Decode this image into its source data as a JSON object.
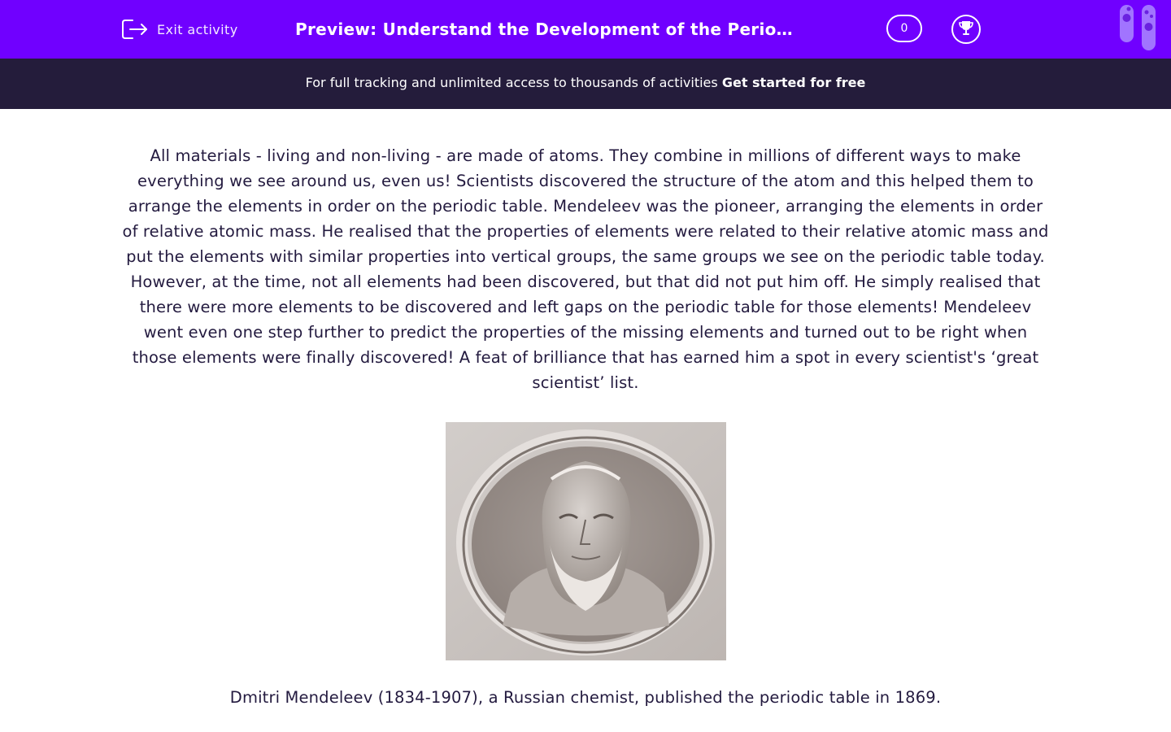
{
  "header": {
    "exit_label": "Exit activity",
    "title": "Preview: Understand the Development of the Periodic Table",
    "score": "0",
    "colors": {
      "primary": "#7000ff",
      "banner": "#241c3b",
      "text": "#231a3f"
    },
    "icons": {
      "exit": "exit-icon",
      "trophy": "trophy-icon",
      "tubes": "test-tubes-icon"
    }
  },
  "banner": {
    "text": "For full tracking and unlimited access to thousands of activities ",
    "link": "Get started for free"
  },
  "main": {
    "paragraph": "All materials - living and non-living - are made of atoms. They combine in millions of different ways to make everything we see around us, even us! Scientists discovered the structure of the atom and this helped them to arrange the elements in order on the periodic table. Mendeleev was the pioneer, arranging the elements in order of relative atomic mass. He realised that the properties of elements were related to their relative atomic mass and put the elements with similar properties into vertical groups, the same groups we see on the periodic table today. However, at the time, not all elements had been discovered, but that did not put him off. He simply realised that there were more elements to be discovered and left gaps on the periodic table for those elements! Mendeleev went even one step further to predict the properties of the missing elements and turned out to be right when those elements were finally discovered! A feat of brilliance that has earned him a spot in every scientist's ‘great scientist’ list.",
    "caption": "Dmitri Mendeleev (1834-1907), a Russian chemist, published the periodic table in 1869."
  }
}
